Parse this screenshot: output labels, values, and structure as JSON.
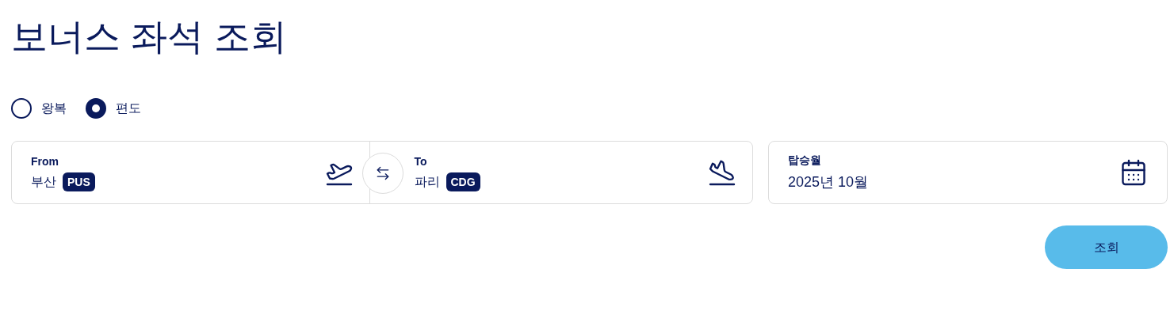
{
  "title": "보너스 좌석 조회",
  "trip_types": [
    {
      "label": "왕복",
      "selected": false
    },
    {
      "label": "편도",
      "selected": true
    }
  ],
  "from": {
    "label": "From",
    "city": "부산",
    "code": "PUS"
  },
  "to": {
    "label": "To",
    "city": "파리",
    "code": "CDG"
  },
  "date": {
    "label": "탑승월",
    "value": "2025년 10월"
  },
  "search_button": "조회"
}
